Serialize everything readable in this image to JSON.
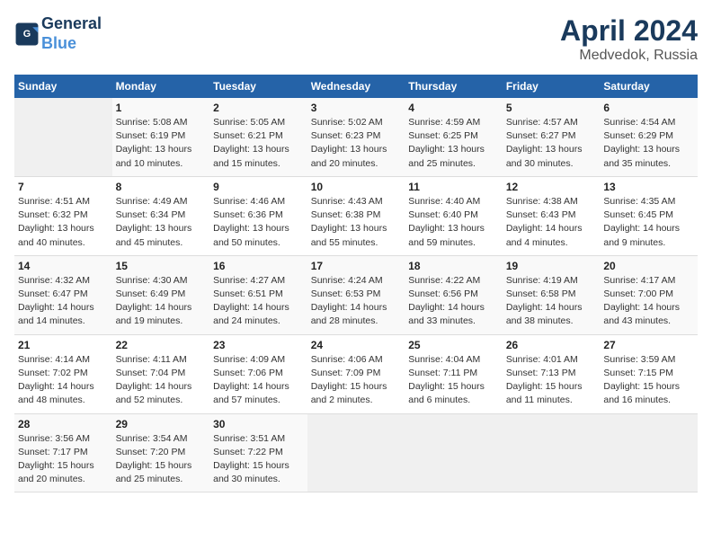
{
  "header": {
    "logo_line1": "General",
    "logo_line2": "Blue",
    "month": "April 2024",
    "location": "Medvedok, Russia"
  },
  "weekdays": [
    "Sunday",
    "Monday",
    "Tuesday",
    "Wednesday",
    "Thursday",
    "Friday",
    "Saturday"
  ],
  "weeks": [
    [
      {
        "day": "",
        "info": ""
      },
      {
        "day": "1",
        "info": "Sunrise: 5:08 AM\nSunset: 6:19 PM\nDaylight: 13 hours\nand 10 minutes."
      },
      {
        "day": "2",
        "info": "Sunrise: 5:05 AM\nSunset: 6:21 PM\nDaylight: 13 hours\nand 15 minutes."
      },
      {
        "day": "3",
        "info": "Sunrise: 5:02 AM\nSunset: 6:23 PM\nDaylight: 13 hours\nand 20 minutes."
      },
      {
        "day": "4",
        "info": "Sunrise: 4:59 AM\nSunset: 6:25 PM\nDaylight: 13 hours\nand 25 minutes."
      },
      {
        "day": "5",
        "info": "Sunrise: 4:57 AM\nSunset: 6:27 PM\nDaylight: 13 hours\nand 30 minutes."
      },
      {
        "day": "6",
        "info": "Sunrise: 4:54 AM\nSunset: 6:29 PM\nDaylight: 13 hours\nand 35 minutes."
      }
    ],
    [
      {
        "day": "7",
        "info": "Sunrise: 4:51 AM\nSunset: 6:32 PM\nDaylight: 13 hours\nand 40 minutes."
      },
      {
        "day": "8",
        "info": "Sunrise: 4:49 AM\nSunset: 6:34 PM\nDaylight: 13 hours\nand 45 minutes."
      },
      {
        "day": "9",
        "info": "Sunrise: 4:46 AM\nSunset: 6:36 PM\nDaylight: 13 hours\nand 50 minutes."
      },
      {
        "day": "10",
        "info": "Sunrise: 4:43 AM\nSunset: 6:38 PM\nDaylight: 13 hours\nand 55 minutes."
      },
      {
        "day": "11",
        "info": "Sunrise: 4:40 AM\nSunset: 6:40 PM\nDaylight: 13 hours\nand 59 minutes."
      },
      {
        "day": "12",
        "info": "Sunrise: 4:38 AM\nSunset: 6:43 PM\nDaylight: 14 hours\nand 4 minutes."
      },
      {
        "day": "13",
        "info": "Sunrise: 4:35 AM\nSunset: 6:45 PM\nDaylight: 14 hours\nand 9 minutes."
      }
    ],
    [
      {
        "day": "14",
        "info": "Sunrise: 4:32 AM\nSunset: 6:47 PM\nDaylight: 14 hours\nand 14 minutes."
      },
      {
        "day": "15",
        "info": "Sunrise: 4:30 AM\nSunset: 6:49 PM\nDaylight: 14 hours\nand 19 minutes."
      },
      {
        "day": "16",
        "info": "Sunrise: 4:27 AM\nSunset: 6:51 PM\nDaylight: 14 hours\nand 24 minutes."
      },
      {
        "day": "17",
        "info": "Sunrise: 4:24 AM\nSunset: 6:53 PM\nDaylight: 14 hours\nand 28 minutes."
      },
      {
        "day": "18",
        "info": "Sunrise: 4:22 AM\nSunset: 6:56 PM\nDaylight: 14 hours\nand 33 minutes."
      },
      {
        "day": "19",
        "info": "Sunrise: 4:19 AM\nSunset: 6:58 PM\nDaylight: 14 hours\nand 38 minutes."
      },
      {
        "day": "20",
        "info": "Sunrise: 4:17 AM\nSunset: 7:00 PM\nDaylight: 14 hours\nand 43 minutes."
      }
    ],
    [
      {
        "day": "21",
        "info": "Sunrise: 4:14 AM\nSunset: 7:02 PM\nDaylight: 14 hours\nand 48 minutes."
      },
      {
        "day": "22",
        "info": "Sunrise: 4:11 AM\nSunset: 7:04 PM\nDaylight: 14 hours\nand 52 minutes."
      },
      {
        "day": "23",
        "info": "Sunrise: 4:09 AM\nSunset: 7:06 PM\nDaylight: 14 hours\nand 57 minutes."
      },
      {
        "day": "24",
        "info": "Sunrise: 4:06 AM\nSunset: 7:09 PM\nDaylight: 15 hours\nand 2 minutes."
      },
      {
        "day": "25",
        "info": "Sunrise: 4:04 AM\nSunset: 7:11 PM\nDaylight: 15 hours\nand 6 minutes."
      },
      {
        "day": "26",
        "info": "Sunrise: 4:01 AM\nSunset: 7:13 PM\nDaylight: 15 hours\nand 11 minutes."
      },
      {
        "day": "27",
        "info": "Sunrise: 3:59 AM\nSunset: 7:15 PM\nDaylight: 15 hours\nand 16 minutes."
      }
    ],
    [
      {
        "day": "28",
        "info": "Sunrise: 3:56 AM\nSunset: 7:17 PM\nDaylight: 15 hours\nand 20 minutes."
      },
      {
        "day": "29",
        "info": "Sunrise: 3:54 AM\nSunset: 7:20 PM\nDaylight: 15 hours\nand 25 minutes."
      },
      {
        "day": "30",
        "info": "Sunrise: 3:51 AM\nSunset: 7:22 PM\nDaylight: 15 hours\nand 30 minutes."
      },
      {
        "day": "",
        "info": ""
      },
      {
        "day": "",
        "info": ""
      },
      {
        "day": "",
        "info": ""
      },
      {
        "day": "",
        "info": ""
      }
    ]
  ]
}
